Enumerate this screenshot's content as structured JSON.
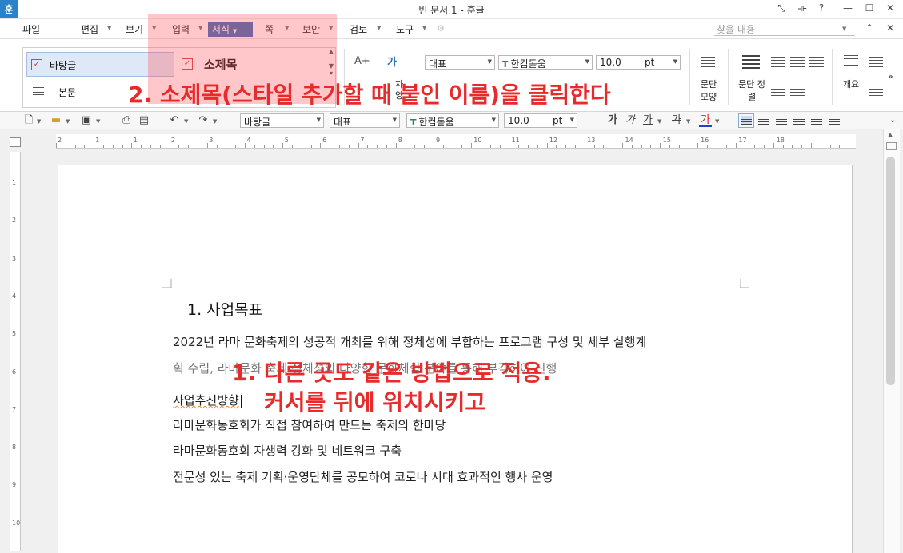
{
  "window": {
    "app_icon": "훈",
    "title": "빈 문서 1 - 훈글",
    "controls": [
      "restore-icon",
      "split-icon",
      "help-icon",
      "minimize-icon",
      "maximize-icon",
      "close-icon"
    ],
    "control_glyphs": [
      "⤡",
      "⟛",
      "?",
      "—",
      "☐",
      "✕"
    ]
  },
  "menu": {
    "items": [
      "파일",
      "편집",
      "보기",
      "입력",
      "서식",
      "쪽",
      "보안",
      "검토",
      "도구"
    ],
    "active": "서식",
    "find_placeholder": "찾을 내용",
    "collapse_glyph": "⌃",
    "close_glyph": "✕"
  },
  "ribbon": {
    "styles": [
      {
        "name": "바탕글",
        "selected": true
      },
      {
        "name": "소제목",
        "selected": false
      },
      {
        "name": "본문",
        "selected": false
      }
    ],
    "char_glyph": "가",
    "style_value": "대표",
    "font_value": "한컴돋움",
    "size_value": "10.0",
    "size_unit": "pt",
    "para_shape_label": "문단 모양",
    "para_align_label": "문단 정렬",
    "outline_label": "개요",
    "cut_text_1": "자",
    "cut_text_2": "양",
    "more_glyph": "»"
  },
  "toolbar": {
    "style_value": "바탕글",
    "lang_value": "대표",
    "font_value": "한컴돋움",
    "size_value": "10.0",
    "size_unit": "pt",
    "bold_glyph": "가",
    "italic_glyph": "가",
    "underline_glyph": "가",
    "strike_glyph": "가",
    "color_glyph": "가"
  },
  "ruler": {
    "h_numbers": [
      "2",
      "1",
      "1",
      "2",
      "3",
      "4",
      "5",
      "6",
      "7",
      "8",
      "9",
      "10",
      "11",
      "12",
      "13",
      "14",
      "15",
      "16",
      "17",
      "18"
    ],
    "v_numbers": [
      "1",
      "2",
      "3",
      "4",
      "5",
      "6",
      "7",
      "8",
      "9",
      "10",
      "1"
    ]
  },
  "document": {
    "heading": "1.  사업목표",
    "lines": [
      "2022년 라마 문화축제의 성공적 개최를 위해 정체성에 부합하는 프로그램 구성 및 세부 실행계",
      "획 수립, 라마문화 축제 정체성의 다양한 문화체험 분야를 통해 부각하여 진행",
      "사업추진방향",
      "라마문화동호회가 직접 참여하여 만드는 축제의 한마당",
      "라마문화동호회 자생력 강화 및 네트워크 구축",
      "전문성 있는 축제 기획·운영단체를 공모하여 코로나 시대 효과적인 행사 운영"
    ]
  },
  "annotations": {
    "step2": "2. 소제목(스타일 추가할 때 붙인 이름)을 클릭한다",
    "step1_line1": "1. 다른 곳도 같은 방법으로 적용.",
    "step1_line2": "커서를 뒤에 위치시키고",
    "color": "#e82a2a"
  }
}
